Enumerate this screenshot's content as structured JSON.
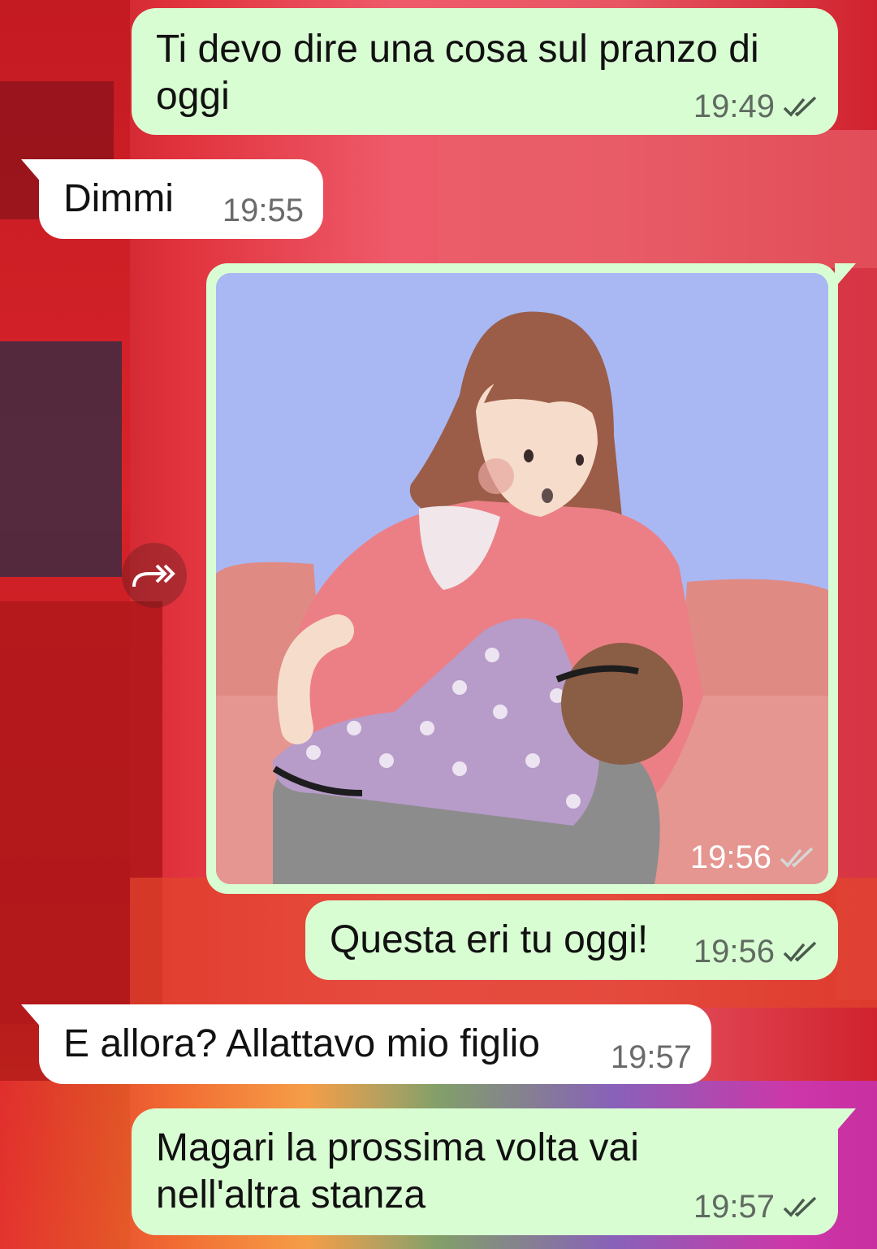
{
  "messages": [
    {
      "direction": "out",
      "text_line1": "Ti devo dire una cosa sul pranzo di",
      "text_line2": "oggi",
      "time": "19:49",
      "status": "read"
    },
    {
      "direction": "in",
      "text": "Dimmi",
      "time": "19:55"
    },
    {
      "direction": "out",
      "type": "image",
      "image_description": "illustration-woman-breastfeeding",
      "time": "19:56",
      "status": "delivered"
    },
    {
      "direction": "out",
      "text": "Questa eri tu oggi!",
      "time": "19:56",
      "status": "read"
    },
    {
      "direction": "in",
      "text": "E allora? Allattavo mio figlio",
      "time": "19:57"
    },
    {
      "direction": "out",
      "text_line1": "Magari la prossima volta vai",
      "text_line2": "nell'altra stanza",
      "time": "19:57",
      "status": "read"
    }
  ],
  "icons": {
    "forward": "forward-icon",
    "read": "double-check-icon"
  },
  "colors": {
    "outgoing_bubble": "#d9fdd3",
    "incoming_bubble": "#ffffff",
    "read_tick": "#4a5a4c"
  }
}
